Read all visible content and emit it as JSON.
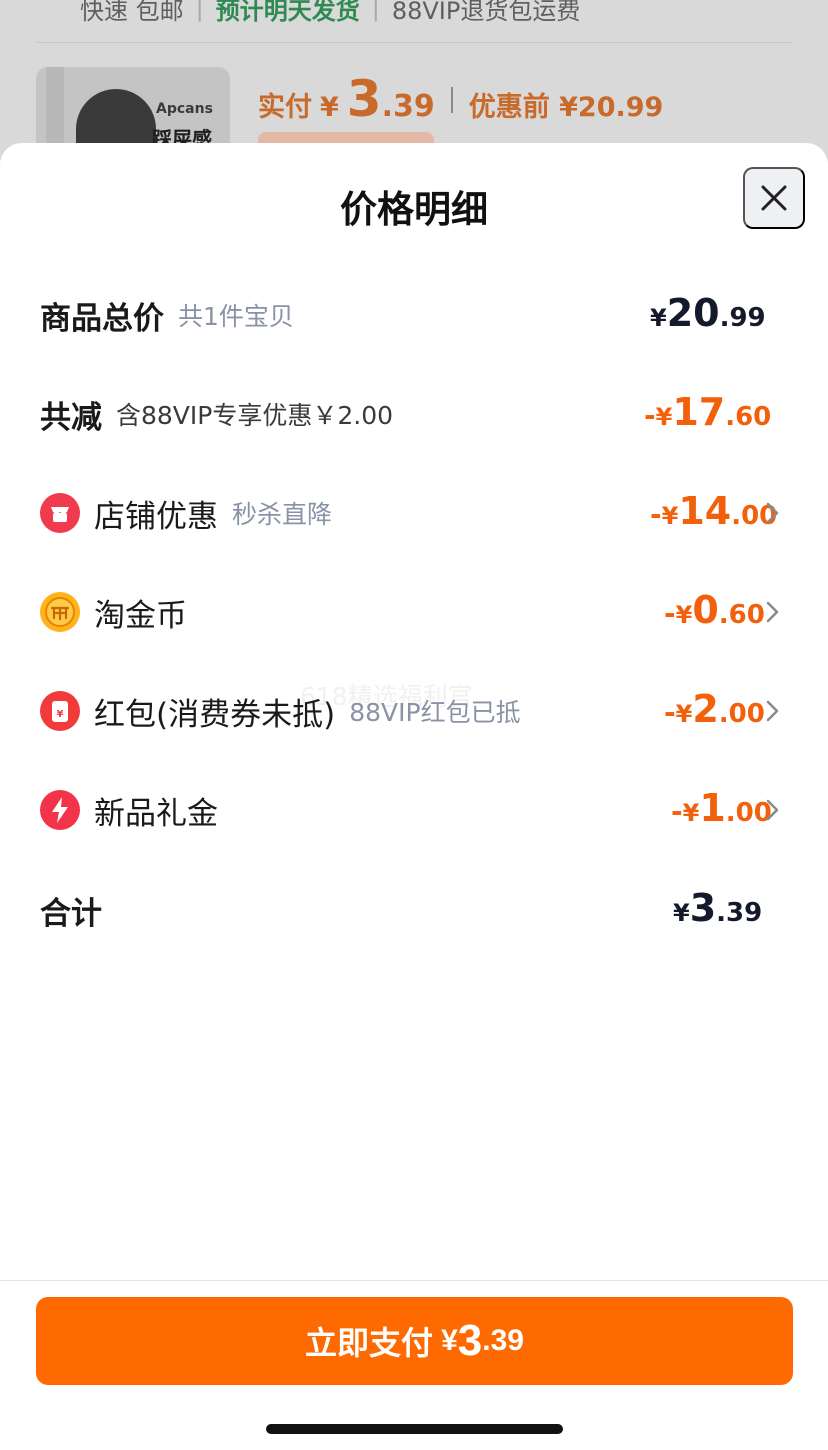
{
  "background": {
    "shipping": {
      "express": "快速 包邮",
      "dispatch": "预计明天发货",
      "vip_return": "88VIP退货包运费"
    },
    "product": {
      "thumb_brand": "Apcans",
      "thumb_slogan": "踩屎感"
    },
    "price": {
      "paid_label": "实付",
      "currency": "¥",
      "paid_int": "3",
      "paid_dec": ".39",
      "before_label": "优惠前 ¥20.99"
    }
  },
  "sheet": {
    "title": "价格明细",
    "close_icon": "close-icon",
    "rows": [
      {
        "label": "商品总价",
        "sub": "共1件宝贝",
        "neg": "",
        "currency": "¥",
        "int": "20",
        "dec": ".99",
        "color": "dark",
        "chevron": false
      },
      {
        "label": "共减",
        "sub": "含88VIP专享优惠￥2.00",
        "neg": "-",
        "currency": "¥",
        "int": "17",
        "dec": ".60",
        "color": "orange",
        "chevron": false
      },
      {
        "icon": "store-icon",
        "label": "店铺优惠",
        "sub": "秒杀直降",
        "neg": "-",
        "currency": "¥",
        "int": "14",
        "dec": ".00",
        "color": "orange",
        "chevron": true
      },
      {
        "icon": "taojin-coin-icon",
        "label": "淘金币",
        "sub": "",
        "neg": "-",
        "currency": "¥",
        "int": "0",
        "dec": ".60",
        "color": "orange",
        "chevron": true
      },
      {
        "icon": "red-packet-icon",
        "label": "红包(消费券未抵)",
        "sub": "88VIP红包已抵",
        "neg": "-",
        "currency": "¥",
        "int": "2",
        "dec": ".00",
        "color": "orange",
        "chevron": true
      },
      {
        "icon": "lightning-icon",
        "label": "新品礼金",
        "sub": "",
        "neg": "-",
        "currency": "¥",
        "int": "1",
        "dec": ".00",
        "color": "orange",
        "chevron": true
      },
      {
        "label": "合计",
        "sub": "",
        "neg": "",
        "currency": "¥",
        "int": "3",
        "dec": ".39",
        "color": "dark",
        "chevron": false
      }
    ],
    "watermark": "618精选福利官"
  },
  "pay_button": {
    "label": "立即支付",
    "currency": "¥",
    "int": "3",
    "dec": ".39"
  },
  "colors": {
    "accent": "#ff6a00",
    "discount": "#f2600c",
    "amount_dark": "#141a2b",
    "subtext": "#8a93a6"
  }
}
